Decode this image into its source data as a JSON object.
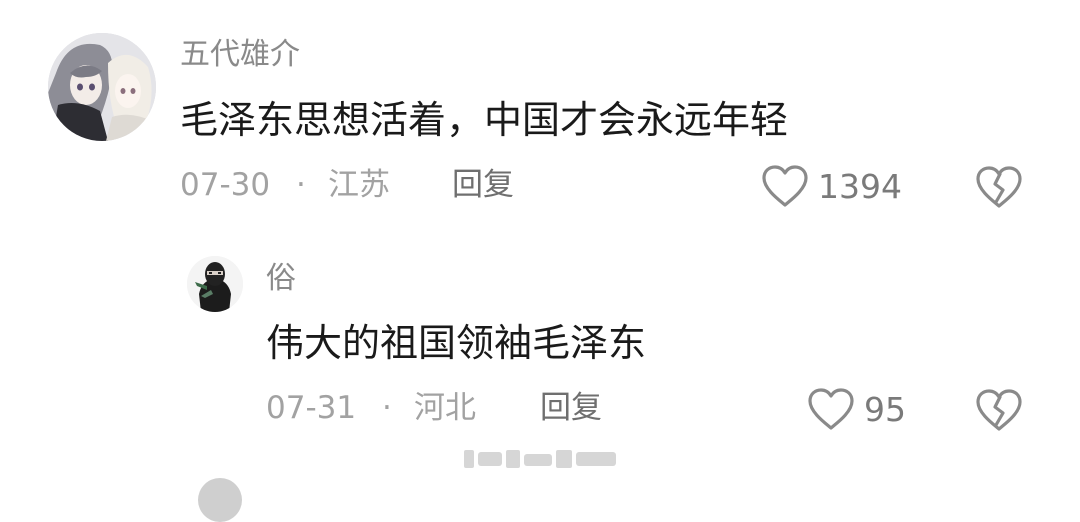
{
  "comments": [
    {
      "username": "五代雄介",
      "text": "毛泽东思想活着，中国才会永远年轻",
      "date": "07-30",
      "separator": "·",
      "location": "江苏",
      "reply_label": "回复",
      "likes": "1394"
    }
  ],
  "replies": [
    {
      "username": "俗",
      "text": "伟大的祖国领袖毛泽东",
      "date": "07-31",
      "separator": "·",
      "location": "河北",
      "reply_label": "回复",
      "likes": "95"
    }
  ],
  "icons": {
    "like": "heart-outline-icon",
    "dislike": "broken-heart-icon"
  },
  "colors": {
    "primary_text": "#1a1a1a",
    "username": "#8a8a8a",
    "meta": "#a2a2a2",
    "icon": "#8a8a8a"
  }
}
